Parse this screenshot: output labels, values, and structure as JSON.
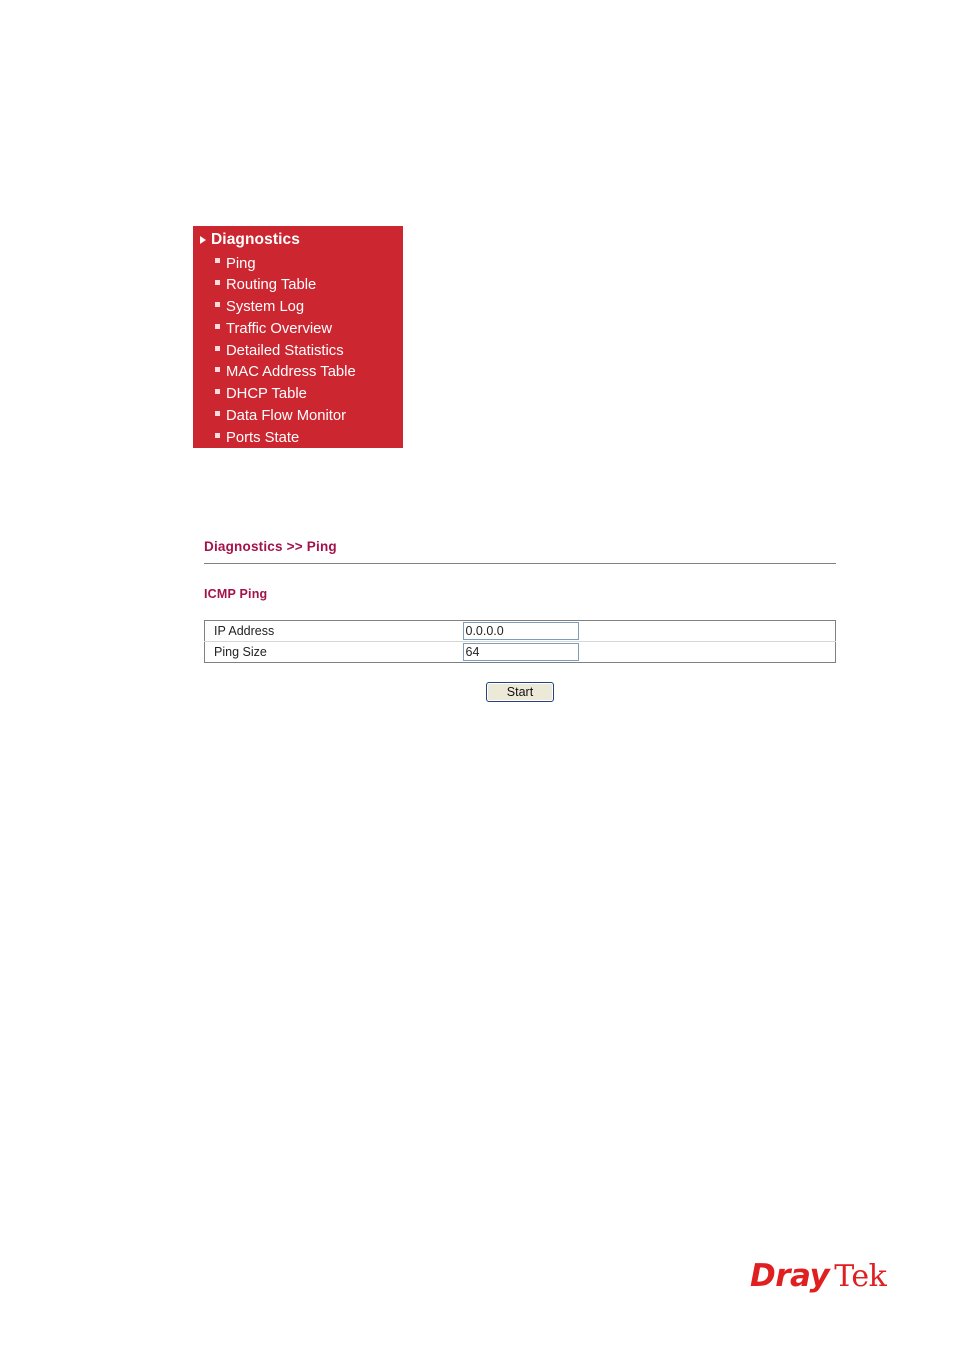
{
  "menu": {
    "header": {
      "label": "Diagnostics",
      "icon": "triangle-right-icon"
    },
    "items": [
      {
        "label": "Ping"
      },
      {
        "label": "Routing Table"
      },
      {
        "label": "System Log"
      },
      {
        "label": "Traffic Overview"
      },
      {
        "label": "Detailed Statistics"
      },
      {
        "label": "MAC Address Table"
      },
      {
        "label": "DHCP Table"
      },
      {
        "label": "Data Flow Monitor"
      },
      {
        "label": "Ports State"
      }
    ],
    "background_color": "#cc2631",
    "text_color": "#ffffff"
  },
  "content": {
    "breadcrumb": "Diagnostics >> Ping",
    "section_title": "ICMP Ping",
    "heading_color": "#a3124a",
    "fields": [
      {
        "label": "IP Address",
        "value": "0.0.0.0"
      },
      {
        "label": "Ping Size",
        "value": "64"
      }
    ],
    "start_button": "Start"
  },
  "footer": {
    "brand_first": "Dray",
    "brand_second": "Tek",
    "brand_color": "#e02020"
  }
}
